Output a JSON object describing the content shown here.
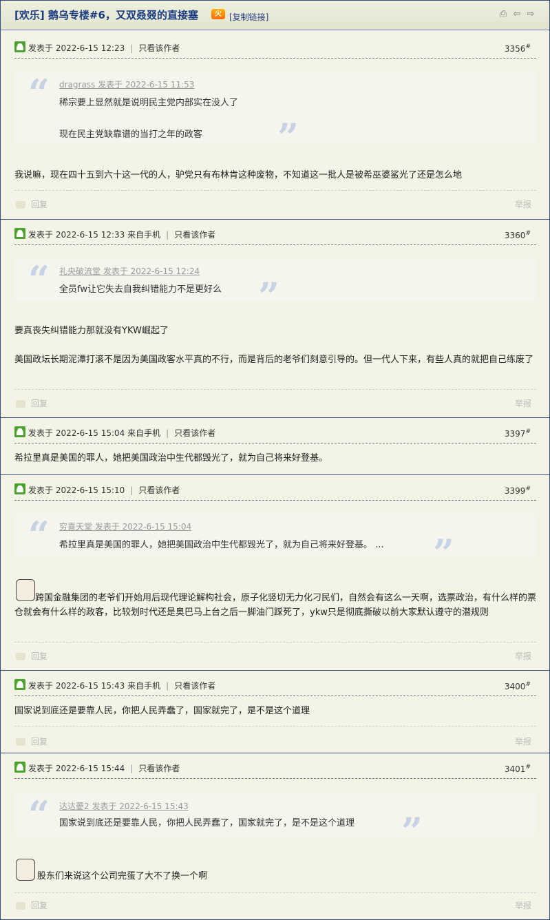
{
  "thread": {
    "title": "[欢乐] 鹅乌专楼#6，又双叒叕的直接塞",
    "hot_badge": "火",
    "copy_link": "[复制链接]"
  },
  "toolbar_icons": [
    "print-icon",
    "prev-thread-icon",
    "next-thread-icon"
  ],
  "labels": {
    "only_author": "只看该作者",
    "reply": "回复",
    "report": "举报",
    "floor_suffix": "#"
  },
  "posts": [
    {
      "time": "发表于 2022-6-15 12:23",
      "floor": "3356",
      "quote": {
        "author": "dragrass 发表于 2022-6-15 11:53",
        "lines": [
          "稀宗要上显然就是说明民主党内部实在没人了",
          "现在民主党缺靠谱的当打之年的政客"
        ]
      },
      "body": [
        "我说嘛，现在四十五到六十这一代的人，驴党只有布林肯这种废物，不知道这一批人是被希巫婆鲨光了还是怎么地"
      ]
    },
    {
      "time": "发表于 2022-6-15 12:33 来自手机",
      "floor": "3360",
      "quote": {
        "author": "礼央破流堂 发表于 2022-6-15 12:24",
        "lines": [
          "全员fw让它失去自我纠错能力不是更好么"
        ]
      },
      "body": [
        "要真丧失纠错能力那就没有YKW崛起了",
        "美国政坛长期泥潭打滚不是因为美国政客水平真的不行，而是背后的老爷们刻意引导的。但一代人下来，有些人真的就把自己练废了"
      ]
    },
    {
      "time": "发表于 2022-6-15 15:04 来自手机",
      "floor": "3397",
      "body": [
        "希拉里真是美国的罪人，她把美国政治中生代都毁光了，就为自己将来好登基。"
      ]
    },
    {
      "time": "发表于 2022-6-15 15:10",
      "floor": "3399",
      "quote": {
        "author": "穷喜天堂 发表于 2022-6-15 15:04",
        "lines": [
          "希拉里真是美国的罪人，她把美国政治中生代都毁光了，就为自己将来好登基。 ..."
        ]
      },
      "body": [
        "跨国金融集团的老爷们开始用后现代理论解构社会，原子化竖切无力化刁民们，自然会有这么一天啊，选票政治，有什么样的票仓就会有什么样的政客，比较划时代还是奥巴马上台之后一脚油门踩死了，ykw只是彻底撕破以前大家默认遵守的潜规则"
      ]
    },
    {
      "time": "发表于 2022-6-15 15:43 来自手机",
      "floor": "3400",
      "body": [
        "国家说到底还是要靠人民，你把人民弄蠢了，国家就完了，是不是这个道理"
      ]
    },
    {
      "time": "发表于 2022-6-15 15:44",
      "floor": "3401",
      "quote": {
        "author": "达达薆2 发表于 2022-6-15 15:43",
        "lines": [
          "国家说到底还是要靠人民，你把人民弄蠢了，国家就完了，是不是这个道理"
        ]
      },
      "body": [
        "股东们来说这个公司完蛋了大不了换一个啊"
      ]
    }
  ]
}
